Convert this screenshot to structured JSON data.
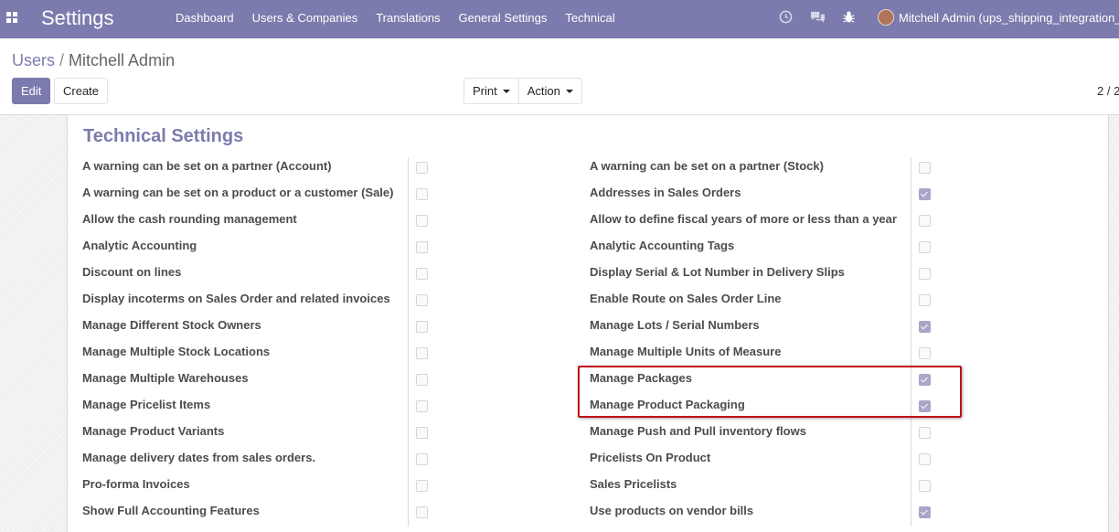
{
  "navbar": {
    "brand": "Settings",
    "menu": [
      "Dashboard",
      "Users & Companies",
      "Translations",
      "General Settings",
      "Technical"
    ],
    "user_label": "Mitchell Admin (ups_shipping_integration_",
    "accent_color": "#7c7bad"
  },
  "breadcrumb": {
    "parent": "Users",
    "separator": "/",
    "current": "Mitchell Admin"
  },
  "buttons": {
    "edit": "Edit",
    "create": "Create",
    "print": "Print",
    "action": "Action"
  },
  "pager": "2 / 2",
  "section": {
    "title": "Technical Settings"
  },
  "left_settings": [
    {
      "label": "A warning can be set on a partner (Account)",
      "checked": false
    },
    {
      "label": "A warning can be set on a product or a customer (Sale)",
      "checked": false
    },
    {
      "label": "Allow the cash rounding management",
      "checked": false
    },
    {
      "label": "Analytic Accounting",
      "checked": false
    },
    {
      "label": "Discount on lines",
      "checked": false
    },
    {
      "label": "Display incoterms on Sales Order and related invoices",
      "checked": false
    },
    {
      "label": "Manage Different Stock Owners",
      "checked": false
    },
    {
      "label": "Manage Multiple Stock Locations",
      "checked": false
    },
    {
      "label": "Manage Multiple Warehouses",
      "checked": false
    },
    {
      "label": "Manage Pricelist Items",
      "checked": false
    },
    {
      "label": "Manage Product Variants",
      "checked": false
    },
    {
      "label": "Manage delivery dates from sales orders.",
      "checked": false
    },
    {
      "label": "Pro-forma Invoices",
      "checked": false
    },
    {
      "label": "Show Full Accounting Features",
      "checked": false
    }
  ],
  "right_settings": [
    {
      "label": "A warning can be set on a partner (Stock)",
      "checked": false
    },
    {
      "label": "Addresses in Sales Orders",
      "checked": true
    },
    {
      "label": "Allow to define fiscal years of more or less than a year",
      "checked": false
    },
    {
      "label": "Analytic Accounting Tags",
      "checked": false
    },
    {
      "label": "Display Serial & Lot Number in Delivery Slips",
      "checked": false
    },
    {
      "label": "Enable Route on Sales Order Line",
      "checked": false
    },
    {
      "label": "Manage Lots / Serial Numbers",
      "checked": true
    },
    {
      "label": "Manage Multiple Units of Measure",
      "checked": false
    },
    {
      "label": "Manage Packages",
      "checked": true
    },
    {
      "label": "Manage Product Packaging",
      "checked": true
    },
    {
      "label": "Manage Push and Pull inventory flows",
      "checked": false
    },
    {
      "label": "Pricelists On Product",
      "checked": false
    },
    {
      "label": "Sales Pricelists",
      "checked": false
    },
    {
      "label": "Use products on vendor bills",
      "checked": true
    }
  ]
}
